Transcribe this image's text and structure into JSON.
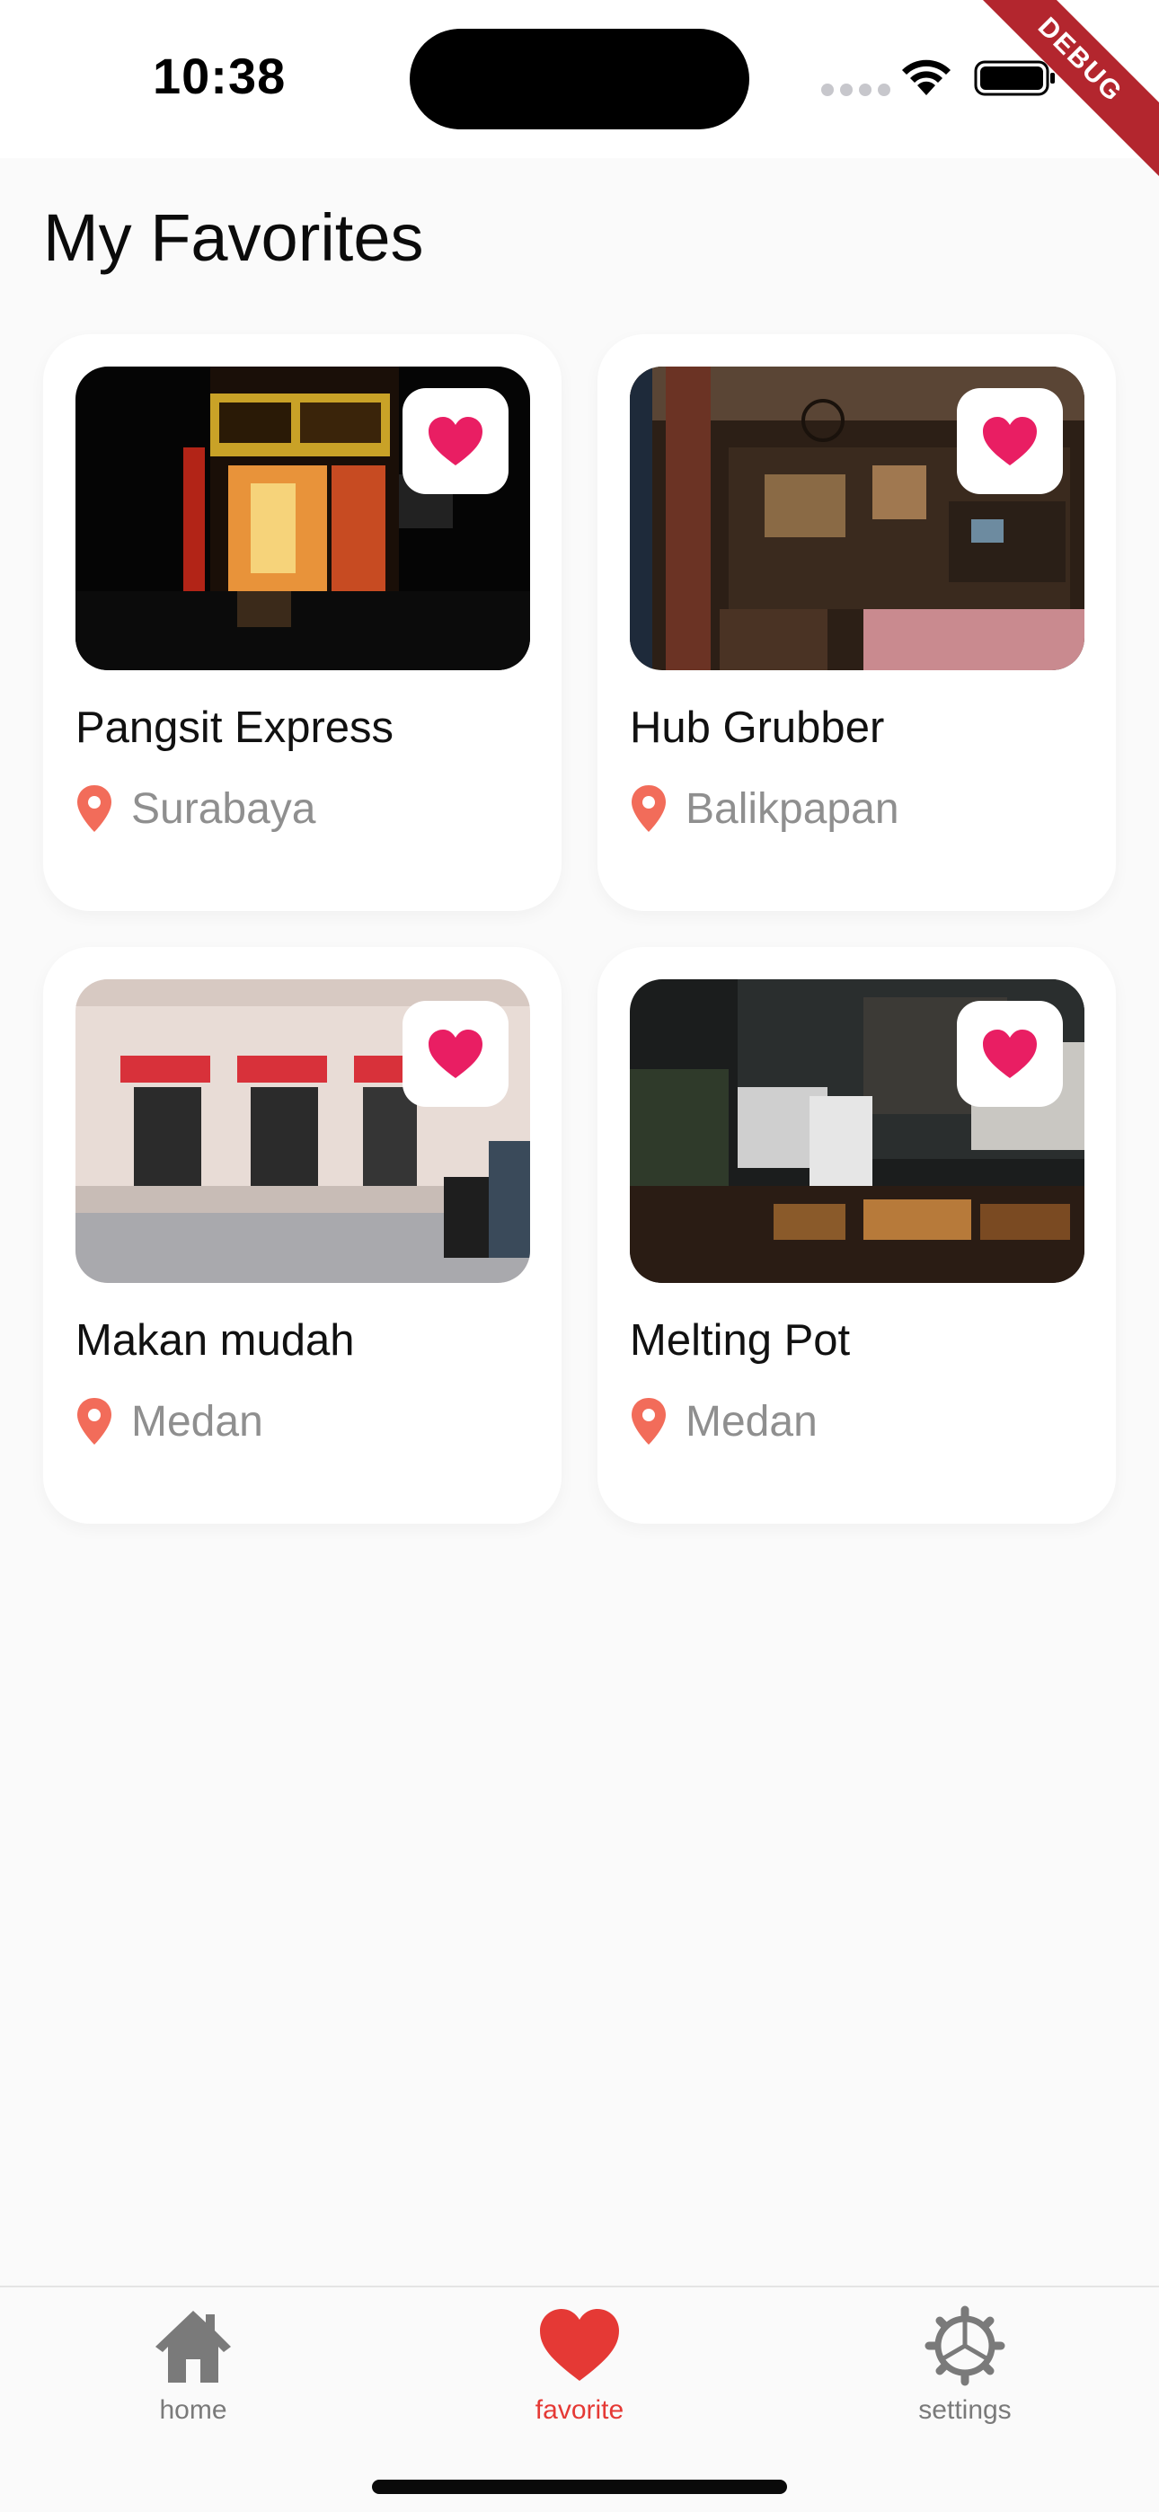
{
  "status_bar": {
    "time": "10:38",
    "debug_banner": "DEBUG"
  },
  "page": {
    "title": "My Favorites"
  },
  "colors": {
    "accent": "#e91e63",
    "pin": "#f26c5a",
    "nav_active": "#e53935",
    "nav_inactive": "#7a7a7a"
  },
  "favorites": [
    {
      "name": "Pangsit Express",
      "location": "Surabaya",
      "icon": "heart-icon"
    },
    {
      "name": "Hub Grubber",
      "location": "Balikpapan",
      "icon": "heart-icon"
    },
    {
      "name": "Makan mudah",
      "location": "Medan",
      "icon": "heart-icon"
    },
    {
      "name": "Melting Pot",
      "location": "Medan",
      "icon": "heart-icon"
    }
  ],
  "bottom_nav": {
    "items": [
      {
        "label": "home",
        "icon": "home-icon"
      },
      {
        "label": "favorite",
        "icon": "heart-icon"
      },
      {
        "label": "settings",
        "icon": "gear-icon"
      }
    ],
    "active": "favorite"
  }
}
